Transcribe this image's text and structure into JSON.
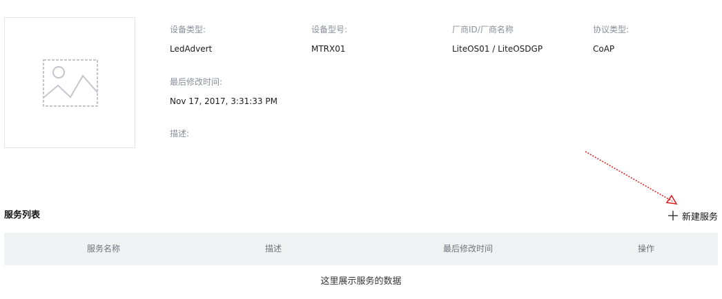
{
  "device": {
    "image_icon": "image-placeholder-icon",
    "fields": {
      "type": {
        "label": "设备类型:",
        "value": "LedAdvert"
      },
      "model": {
        "label": "设备型号:",
        "value": "MTRX01"
      },
      "vendor": {
        "label": "厂商ID/厂商名称",
        "value": "LiteOS01 / LiteOSDGP"
      },
      "protocol": {
        "label": "协议类型:",
        "value": "CoAP"
      },
      "modified": {
        "label": "最后修改时间:",
        "value": "Nov 17, 2017, 3:31:33 PM"
      },
      "description": {
        "label": "描述:",
        "value": ""
      }
    }
  },
  "services": {
    "title": "服务列表",
    "new_button": {
      "label": "新建服务",
      "icon": "plus-icon"
    },
    "columns": [
      "服务名称",
      "描述",
      "最后修改时间",
      "操作"
    ],
    "empty_text": "这里展示服务的数据"
  },
  "annotation": {
    "color": "#e02020",
    "icon": "dotted-arrow-icon"
  }
}
